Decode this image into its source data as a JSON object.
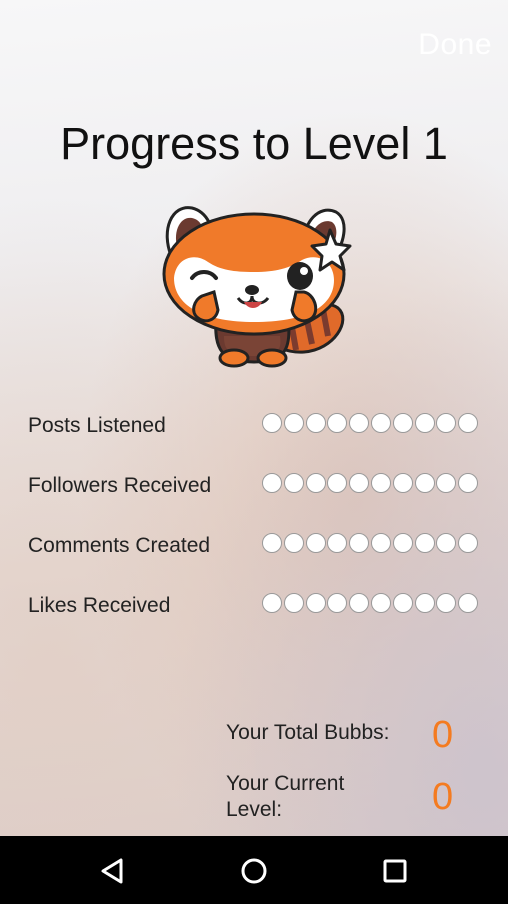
{
  "header": {
    "done_label": "Done"
  },
  "title": "Progress to Level 1",
  "mascot": {
    "icon": "red-panda-mascot-icon"
  },
  "progress": [
    {
      "label": "Posts Listened",
      "filled": 0,
      "total": 10
    },
    {
      "label": "Followers Received",
      "filled": 0,
      "total": 10
    },
    {
      "label": "Comments Created",
      "filled": 0,
      "total": 10
    },
    {
      "label": "Likes Received",
      "filled": 0,
      "total": 10
    }
  ],
  "stats": {
    "total_bubbs_label": "Your Total Bubbs:",
    "total_bubbs_value": "0",
    "current_level_label_line1": "Your Current",
    "current_level_label_line2": "Level:",
    "current_level_value": "0"
  },
  "navbar": {
    "back_icon": "back-triangle-icon",
    "home_icon": "home-circle-icon",
    "recents_icon": "recents-square-icon"
  },
  "colors": {
    "accent": "#f47b20",
    "navbar_bg": "#000000",
    "done_text": "#ffffff"
  }
}
